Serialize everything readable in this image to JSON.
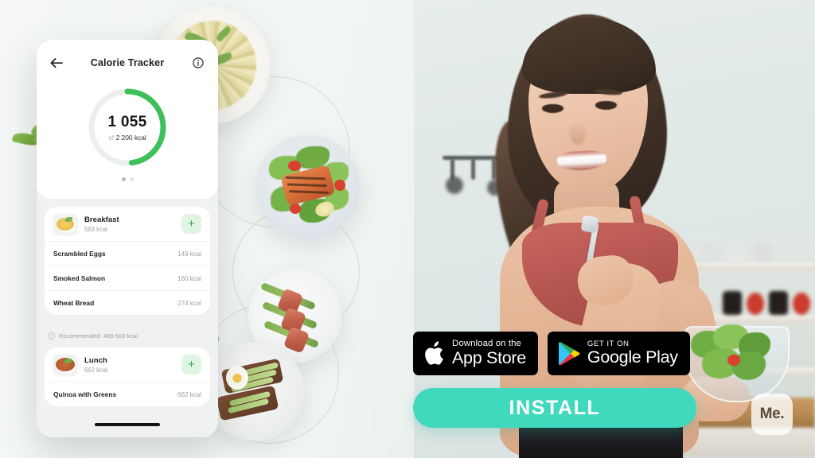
{
  "app": {
    "logo_text": "Me.",
    "install_label": "INSTALL"
  },
  "store_badges": [
    {
      "name": "app-store",
      "small_text": "Download on the",
      "big_text": "App Store",
      "icon": "apple-icon"
    },
    {
      "name": "google-play",
      "small_text": "GET IT ON",
      "big_text": "Google Play",
      "icon": "google-play-icon"
    }
  ],
  "phone": {
    "header": {
      "back_icon": "back-arrow-icon",
      "title": "Calorie Tracker",
      "info_icon": "info-icon"
    },
    "ring": {
      "value": "1 055",
      "of_label": "of",
      "goal": "2 200 kcal",
      "percent": 48,
      "track_color": "#ecefee",
      "progress_color": "#3fbf5a"
    },
    "pager": {
      "total": 2,
      "active": 0
    },
    "meals": [
      {
        "name": "Breakfast",
        "kcal": "583 kcal",
        "thumb": "scrambled-eggs-thumb",
        "add_label": "+",
        "items": [
          {
            "name": "Scrambled Eggs",
            "kcal": "149 kcal"
          },
          {
            "name": "Smoked Salmon",
            "kcal": "160 kcal"
          },
          {
            "name": "Wheat Bread",
            "kcal": "274 kcal"
          }
        ]
      },
      {
        "name": "Lunch",
        "kcal": "662 kcal",
        "thumb": "lunch-bowl-thumb",
        "add_label": "+",
        "items": [
          {
            "name": "Quinoa with Greens",
            "kcal": "662 kcal"
          }
        ]
      }
    ],
    "recommendation": {
      "icon": "info-circle-icon",
      "text": "Recommended: 400-500 kcal"
    }
  },
  "food_circles": [
    {
      "name": "pasta-with-greens-photo"
    },
    {
      "name": "grilled-salmon-salad-photo"
    },
    {
      "name": "bacon-wrapped-asparagus-photo"
    },
    {
      "name": "avocado-toast-photo"
    }
  ],
  "scene": {
    "model": "smiling-woman-holding-salad-bowl",
    "background": "bright-kitchen"
  },
  "colors": {
    "install_teal": "#40d9bd",
    "progress_green": "#3fbf5a",
    "add_button_bg": "#dff4e2",
    "badge_black": "#000000",
    "page_bg": "#eef3f1"
  }
}
